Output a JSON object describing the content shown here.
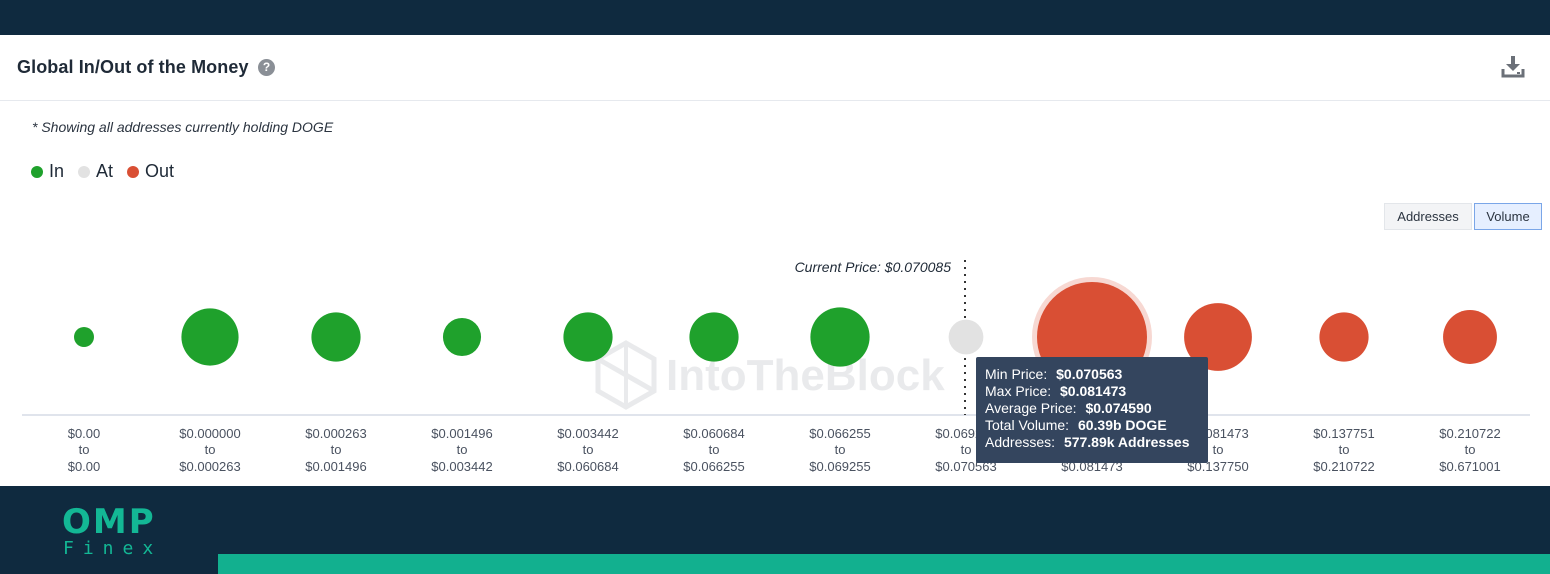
{
  "header": {
    "title": "Global In/Out of the Money",
    "help_icon": "question-circle-icon",
    "download_icon": "download-icon"
  },
  "note": "* Showing all addresses currently holding DOGE",
  "legend": [
    {
      "label": "In",
      "color": "#1fa12c"
    },
    {
      "label": "At",
      "color": "#e2e2e2"
    },
    {
      "label": "Out",
      "color": "#d94f34"
    }
  ],
  "toggles": {
    "addresses": "Addresses",
    "volume": "Volume",
    "selected": "Volume"
  },
  "watermark": "IntoTheBlock",
  "current_price_label": "Current Price: $0.070085",
  "chart_data": {
    "type": "scatter",
    "title": "Global In/Out of the Money",
    "current_price": 0.070085,
    "categories": [
      {
        "from": "$0.00",
        "to": "$0.00",
        "status": "In",
        "volume_rel": 0.03
      },
      {
        "from": "$0.000000",
        "to": "$0.000263",
        "status": "In",
        "volume_rel": 0.27
      },
      {
        "from": "$0.000263",
        "to": "$0.001496",
        "status": "In",
        "volume_rel": 0.2
      },
      {
        "from": "$0.001496",
        "to": "$0.003442",
        "status": "In",
        "volume_rel": 0.12
      },
      {
        "from": "$0.003442",
        "to": "$0.060684",
        "status": "In",
        "volume_rel": 0.2
      },
      {
        "from": "$0.060684",
        "to": "$0.066255",
        "status": "In",
        "volume_rel": 0.2
      },
      {
        "from": "$0.066255",
        "to": "$0.069255",
        "status": "In",
        "volume_rel": 0.29
      },
      {
        "from": "$0.069255",
        "to": "$0.070563",
        "status": "At",
        "volume_rel": 0.1
      },
      {
        "from": "$0.070563",
        "to": "$0.081473",
        "status": "Out",
        "volume_rel": 1.0
      },
      {
        "from": "$0.081473",
        "to": "$0.137750",
        "status": "Out",
        "volume_rel": 0.38
      },
      {
        "from": "$0.137751",
        "to": "$0.210722",
        "status": "Out",
        "volume_rel": 0.2
      },
      {
        "from": "$0.210722",
        "to": "$0.671001",
        "status": "Out",
        "volume_rel": 0.24
      }
    ]
  },
  "tooltip": {
    "min_price_label": "Min Price:",
    "min_price_value": "$0.070563",
    "max_price_label": "Max Price:",
    "max_price_value": "$0.081473",
    "avg_price_label": "Average Price:",
    "avg_price_value": "$0.074590",
    "volume_label": "Total Volume:",
    "volume_value": "60.39b DOGE",
    "addresses_label": "Addresses:",
    "addresses_value": "577.89k Addresses"
  },
  "footer": {
    "logo_top": "OMP",
    "logo_bottom": "Finex"
  }
}
